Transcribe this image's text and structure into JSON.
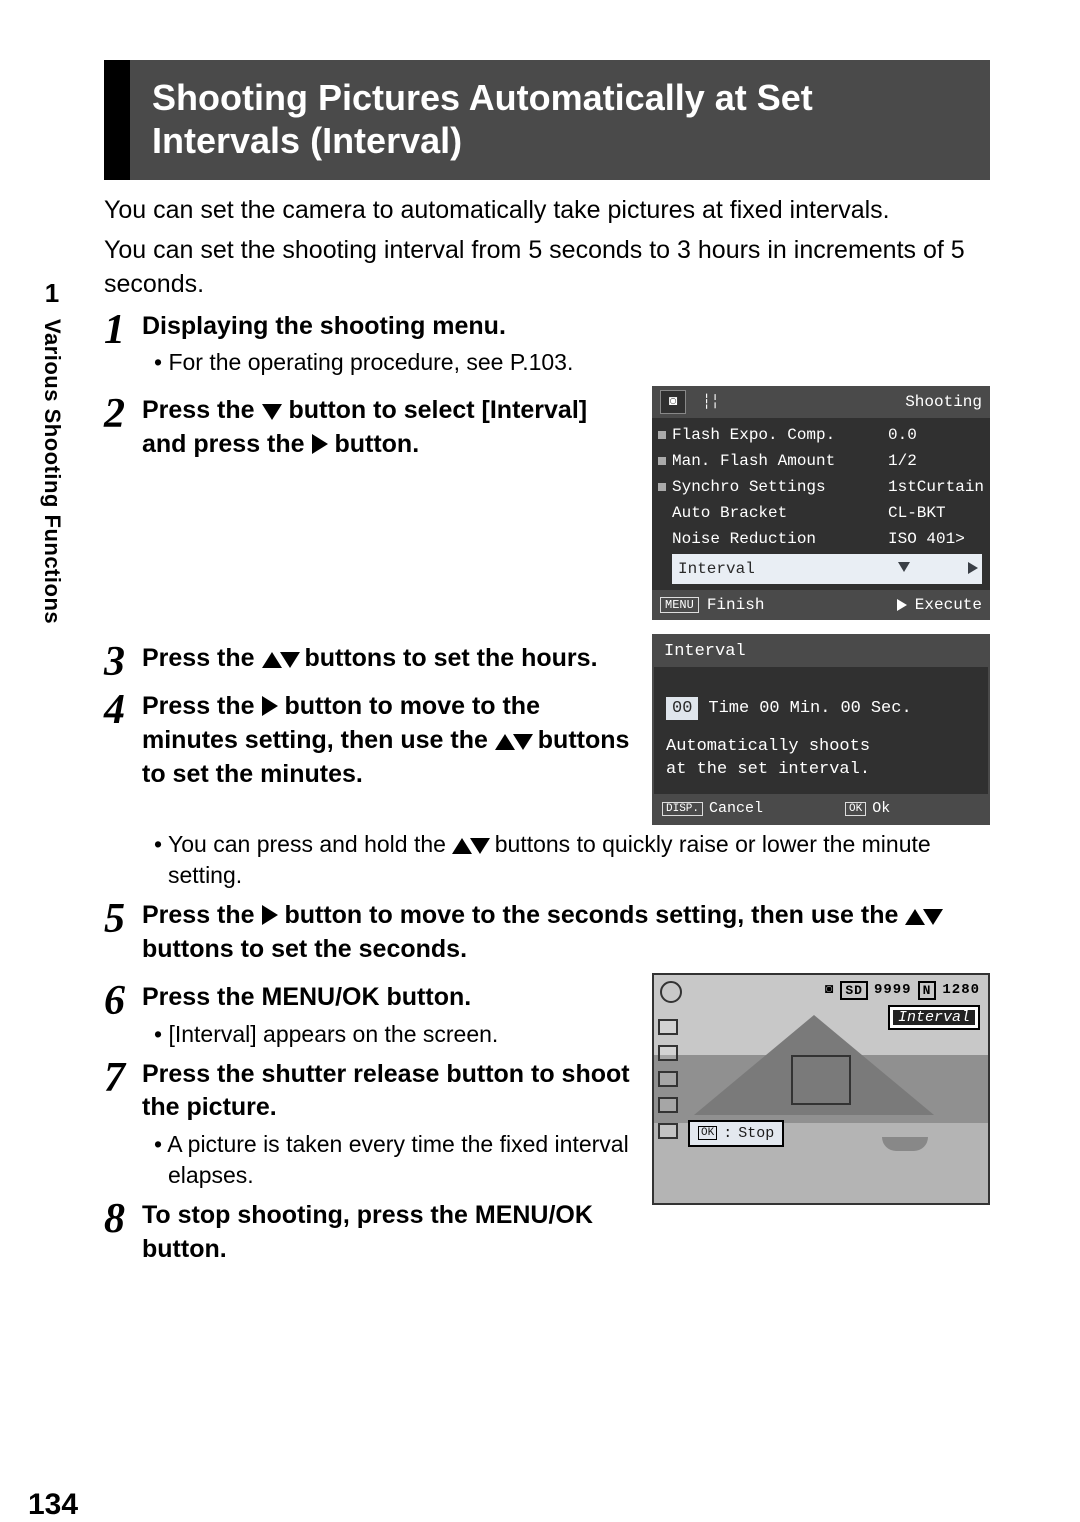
{
  "page_number": "134",
  "sidebar": {
    "chapter": "1",
    "label": "Various Shooting Functions"
  },
  "title": "Shooting Pictures Automatically at Set Intervals (Interval)",
  "intro1": "You can set the camera to automatically take pictures at fixed intervals.",
  "intro2": "You can set the shooting interval from 5 seconds to 3 hours in increments of 5 seconds.",
  "steps": {
    "s1": {
      "num": "1",
      "title": "Displaying the shooting menu.",
      "bullet": "For the operating procedure, see P.103."
    },
    "s2": {
      "num": "2",
      "pre": "Press the ",
      "mid1": " button to select [Interval] and press the ",
      "post": " button."
    },
    "s3": {
      "num": "3",
      "pre": "Press the ",
      "post": " buttons to set the hours."
    },
    "s4": {
      "num": "4",
      "pre": "Press the ",
      "mid1": " button to move to the minutes setting, then use the ",
      "post": " buttons to set the minutes.",
      "bullet_pre": "You can press and hold the ",
      "bullet_post": " buttons to quickly raise or lower the minute setting."
    },
    "s5": {
      "num": "5",
      "pre": "Press the ",
      "mid1": " button to move to the seconds setting, then use the ",
      "post": " buttons to set the seconds."
    },
    "s6": {
      "num": "6",
      "title": "Press the MENU/OK button.",
      "bullet": "[Interval] appears on the screen."
    },
    "s7": {
      "num": "7",
      "title": "Press the shutter release button to shoot the picture.",
      "bullet": "A picture is taken every time the fixed interval elapses."
    },
    "s8": {
      "num": "8",
      "title": "To stop shooting, press the MENU/OK button."
    }
  },
  "lcd1": {
    "header_right": "Shooting",
    "rows": [
      {
        "k": "Flash Expo. Comp.",
        "v": "0.0"
      },
      {
        "k": "Man. Flash Amount",
        "v": "1/2"
      },
      {
        "k": "Synchro Settings",
        "v": "1stCurtain"
      },
      {
        "k": "Auto Bracket",
        "v": "CL-BKT"
      },
      {
        "k": "Noise Reduction",
        "v": "ISO 401>"
      }
    ],
    "selected": "Interval",
    "foot_left_box": "MENU",
    "foot_left": "Finish",
    "foot_right": "Execute"
  },
  "lcd2": {
    "title": "Interval",
    "time_hh": "00",
    "time_label": "Time",
    "min_mm": "00",
    "min_label": "Min.",
    "sec_ss": "00",
    "sec_label": "Sec.",
    "desc1": "Automatically shoots",
    "desc2": "at the set interval.",
    "foot_disp": "DISP.",
    "foot_cancel": "Cancel",
    "foot_ok_box": "OK",
    "foot_ok": "Ok"
  },
  "lcd3": {
    "sd": "SD",
    "shots": "9999",
    "size_box": "N",
    "size": "1280",
    "interval_tag": "Interval",
    "stop_box": "OK",
    "stop_sep": ":",
    "stop": "Stop"
  }
}
